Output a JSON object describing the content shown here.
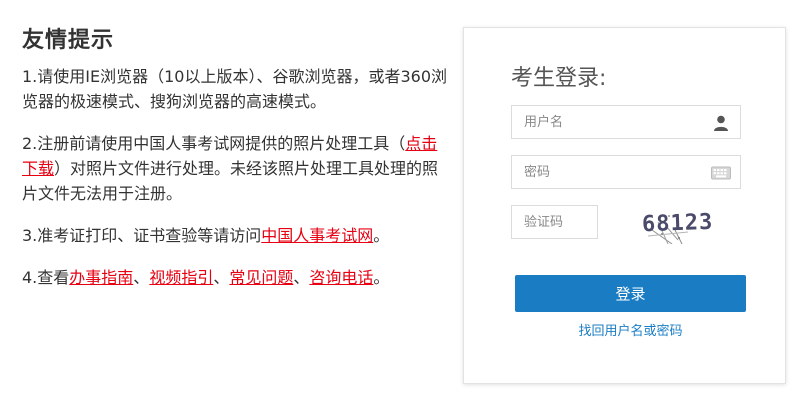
{
  "tips": {
    "title": "友情提示",
    "item1": "1.请使用IE浏览器（10以上版本）、谷歌浏览器，或者360浏览器的极速模式、搜狗浏览器的高速模式。",
    "item2_a": "2.注册前请使用中国人事考试网提供的照片处理工具（",
    "item2_link": "点击下载",
    "item2_b": "）对照片文件进行处理。未经该照片处理工具处理的照片文件无法用于注册。",
    "item3_a": "3.准考证打印、证书查验等请访问",
    "item3_link": "中国人事考试网",
    "item3_b": "。",
    "item4_a": "4.查看",
    "link_guide": "办事指南",
    "sep": "、",
    "link_video": "视频指引",
    "link_faq": "常见问题",
    "link_phone": "咨询电话",
    "item4_end": "。"
  },
  "login": {
    "title": "考生登录:",
    "username_placeholder": "用户名",
    "password_placeholder": "密码",
    "captcha_placeholder": "验证码",
    "captcha_text": "68123",
    "submit_label": "登录",
    "recover_label": "找回用户名或密码"
  },
  "colors": {
    "accent": "#1a7dc4",
    "link_red": "#e60012"
  }
}
